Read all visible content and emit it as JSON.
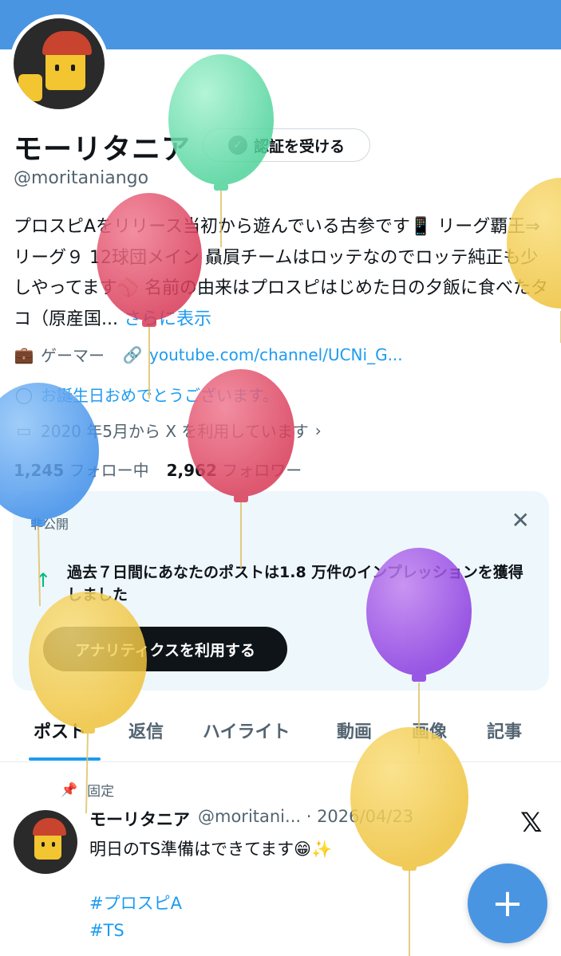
{
  "profile": {
    "name": "モーリタニア",
    "verify_label": "認証を受ける",
    "handle": "@moritaniango",
    "bio": "プロスピAをリリース当初から遊んでいる古参です📱 リーグ覇王⇒リーグ９ 12球団メイン 贔屓チームはロッテなのでロッテ純正も少しやってます⚾️ 名前の由来はプロスピはじめた日の夕飯に食べたタコ（原産国...",
    "bio_more": "さらに表示",
    "category": "ゲーマー",
    "link": "youtube.com/channel/UCNi_G...",
    "birthday": "お誕生日おめでとうございます。",
    "joined": "2020 年5月から X を利用しています",
    "following_count": "1,245",
    "following_label": "フォロー中",
    "followers_count": "2,962",
    "followers_label": "フォロワー"
  },
  "analytics_card": {
    "tag": "非公開",
    "text": "過去７日間にあなたのポストは1.8 万件のインプレッションを獲得しました",
    "button": "アナリティクスを利用する"
  },
  "tabs": [
    "ポスト",
    "返信",
    "ハイライト",
    "動画",
    "画像",
    "記事"
  ],
  "pinned_post": {
    "pin_label": "固定",
    "author": "モーリタニア",
    "handle_date": "@moritani... · 2026/04/23",
    "text": "明日のTS準備はできてます😁✨",
    "hashtag1": "#プロスピA",
    "hashtag2": "#TS"
  },
  "fab_icon": "plus-icon",
  "colors": {
    "banner": "#4a95e2",
    "link": "#1d9bf0",
    "card_bg": "#eef7fb"
  }
}
